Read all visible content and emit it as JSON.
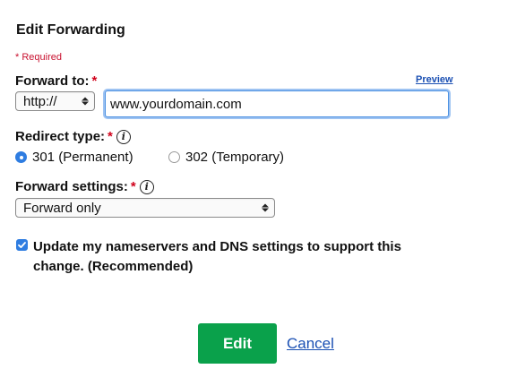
{
  "dialog": {
    "title": "Edit Forwarding",
    "required_note": "* Required"
  },
  "forward_to": {
    "label": "Forward to:",
    "required_mark": "*",
    "preview_link": "Preview",
    "protocol_selected": "http://",
    "url_value": "www.yourdomain.com"
  },
  "redirect_type": {
    "label": "Redirect type:",
    "required_mark": "*",
    "info_icon": "i",
    "options": [
      {
        "label": "301 (Permanent)",
        "checked": true
      },
      {
        "label": "302 (Temporary)",
        "checked": false
      }
    ]
  },
  "forward_settings": {
    "label": "Forward settings:",
    "required_mark": "*",
    "info_icon": "i",
    "selected": "Forward only"
  },
  "nameserver_option": {
    "checked": true,
    "text": "Update my nameservers and DNS settings to support this change. (Recommended)"
  },
  "actions": {
    "edit_label": "Edit",
    "cancel_label": "Cancel"
  },
  "colors": {
    "accent_green": "#0aa14b",
    "link_blue": "#1a4fb3",
    "required_red": "#d0021b",
    "control_blue": "#2f7de1"
  }
}
